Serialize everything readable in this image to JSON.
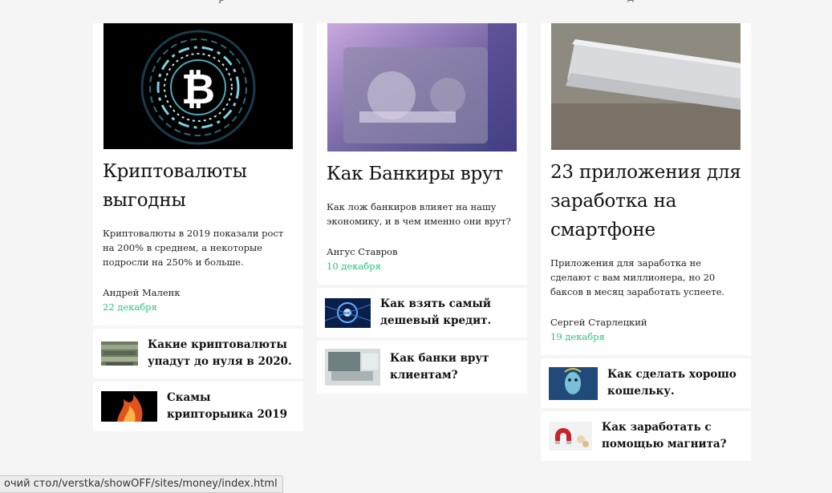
{
  "top_fragments": {
    "left": "р",
    "right": "д"
  },
  "cards": [
    {
      "title": "Криптовалюты выгодны",
      "description": "Криптовалюты в 2019 показали рост на 200% в среднем, а некоторые подросли на 250% и больше.",
      "author": "Андрей Маленк",
      "date": "22 декабря",
      "image": "bitcoin-image",
      "minis": [
        {
          "title": "Какие криптовалюты упадут до нуля в 2020.",
          "image": "money-pile-thumb"
        },
        {
          "title": "Скамы крипторынка 2019",
          "image": "fire-thumb"
        }
      ]
    },
    {
      "title": "Как Банкиры врут",
      "description": "Как лож банкиров влияет на нашу экономику, и в чем именно они врут?",
      "author": "Ангус Ставров",
      "date": "10 декабря",
      "image": "vault-door-image",
      "minis": [
        {
          "title": "Как взять самый дешевый кредит.",
          "image": "network-thumb"
        },
        {
          "title": "Как банки врут клиентам?",
          "image": "laptop-thumb"
        }
      ]
    },
    {
      "title": "23 приложения для заработка на смартфоне",
      "description": "Приложения для заработка не сделают с вам миллионера, но 20 баксов в месяц заработать успеете.",
      "author": "Сергей Старлецкий",
      "date": "19 декабря",
      "image": "smartphones-image",
      "minis": [
        {
          "title": "Как сделать хорошо кошельку.",
          "image": "face-art-thumb"
        },
        {
          "title": "Как заработать с помощью магнита?",
          "image": "magnet-thumb"
        }
      ]
    }
  ],
  "status_url": "очий стол/verstka/showOFF/sites/money/index.html",
  "colors": {
    "date": "#2bc27a",
    "background": "#f5f5f5"
  }
}
